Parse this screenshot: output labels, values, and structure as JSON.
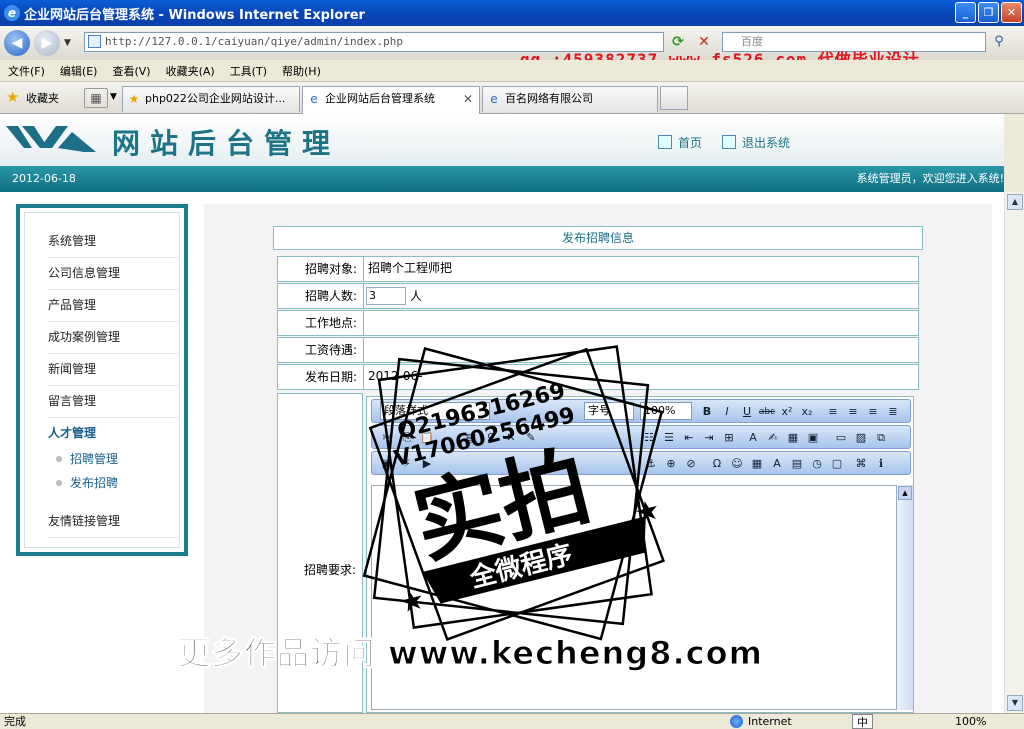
{
  "window": {
    "title": "企业网站后台管理系统 - Windows Internet Explorer",
    "promo": "qq :459382737 www.fs526.com 代做毕业设计"
  },
  "address": {
    "url": "http://127.0.0.1/caiyuan/qiye/admin/index.php",
    "search_placeholder": "百度"
  },
  "menu": [
    "文件(F)",
    "编辑(E)",
    "查看(V)",
    "收藏夹(A)",
    "工具(T)",
    "帮助(H)"
  ],
  "favorites": {
    "label": "收藏夹",
    "tabs": [
      {
        "label": "php022公司企业网站设计..."
      },
      {
        "label": "企业网站后台管理系统"
      },
      {
        "label": "百名网络有限公司"
      }
    ]
  },
  "header": {
    "site_title": "网站后台管理",
    "home_link": "首页",
    "logout_link": "退出系统"
  },
  "infobar": {
    "date": "2012-06-18",
    "welcome": "系统管理员，欢迎您进入系统!"
  },
  "sidebar": {
    "items": [
      "系统管理",
      "公司信息管理",
      "产品管理",
      "成功案例管理",
      "新闻管理",
      "留言管理"
    ],
    "section": "人才管理",
    "subitems": [
      "招聘管理",
      "发布招聘"
    ],
    "last_item": "友情链接管理"
  },
  "form": {
    "title": "发布招聘信息",
    "fields": [
      {
        "label": "招聘对象:",
        "value": "招聘个工程师把"
      },
      {
        "label": "招聘人数:",
        "value": "3",
        "unit": "人"
      },
      {
        "label": "工作地点:",
        "value": ""
      },
      {
        "label": "工资待遇:",
        "value": ""
      },
      {
        "label": "发布日期:",
        "value": "2012-06-"
      }
    ],
    "requirements_label": "招聘要求:"
  },
  "editor": {
    "format_select": "段落样式",
    "size_select": "字号",
    "zoom_select": "100%"
  },
  "stamp": {
    "line1": "Q2196316269",
    "line2": "V17060256499",
    "main": "实拍",
    "banner": "全微程序"
  },
  "watermark": "更多作品访问 www.kecheng8.com",
  "status": {
    "done": "完成",
    "zone": "Internet",
    "ime": "中",
    "zoom": "100%"
  },
  "colors": {
    "accent": "#1a7d8c",
    "titlebar": "#0a4fc8",
    "promo": "#e0141e"
  }
}
